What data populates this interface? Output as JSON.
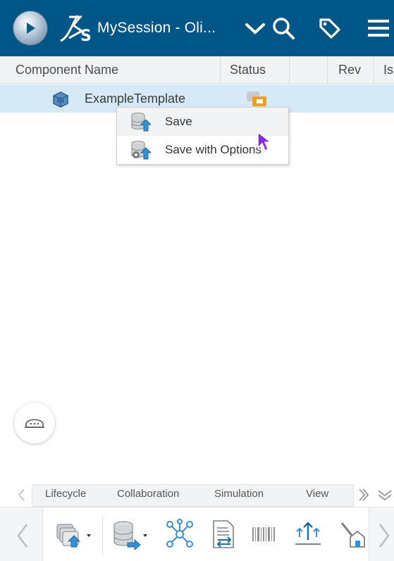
{
  "header": {
    "title": "MySession - Oli...",
    "background": "#005686",
    "icons": [
      "compass-icon",
      "3ds-logo-icon",
      "chevron-down-icon",
      "search-icon",
      "tag-icon",
      "menu-icon"
    ]
  },
  "table": {
    "columns": [
      "Component Name",
      "Status",
      "",
      "Rev",
      "Is"
    ],
    "rows": [
      {
        "name": "ExampleTemplate",
        "selected": true,
        "status_icon": "status-icon"
      }
    ],
    "selection_color": "#d6e9f7"
  },
  "context_menu": {
    "items": [
      {
        "label": "Save",
        "icon": "database-save-icon"
      },
      {
        "label": "Save with Options",
        "icon": "database-save-options-icon"
      }
    ]
  },
  "section_tabs": {
    "items": [
      "Lifecycle",
      "Collaboration",
      "Simulation",
      "View"
    ]
  },
  "toolbar": {
    "buttons": [
      "component-stack-icon",
      "save-database-icon",
      "network-icon",
      "document-compare-icon",
      "barcode-icon",
      "share-upload-icon",
      "edit-house-icon"
    ]
  }
}
